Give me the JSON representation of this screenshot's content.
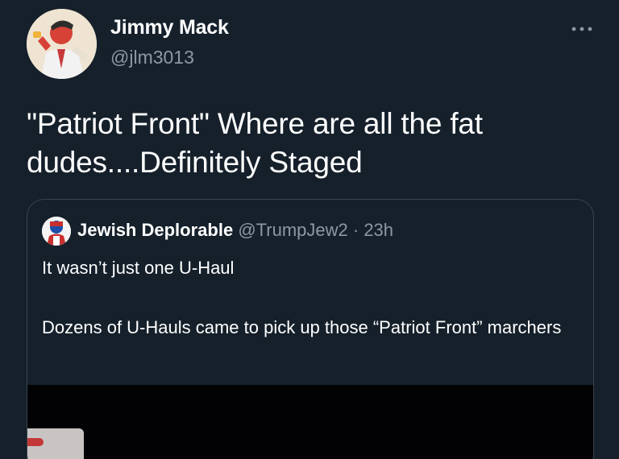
{
  "author": {
    "name": "Jimmy Mack",
    "handle": "@jlm3013"
  },
  "more_glyph": "···",
  "tweet": {
    "text_line1": "\"Patriot Front\" Where are all the fat",
    "text_line2": "dudes....Definitely Staged"
  },
  "quoted_tweet": {
    "name": "Jewish Deplorable",
    "handle": "@TrumpJew2",
    "separator": " · ",
    "time": "23h",
    "paragraph1": "It wasn’t just one U-Haul",
    "paragraph2": "Dozens of U-Hauls came to pick up those “Patriot Front” marchers"
  },
  "colors": {
    "background": "#15202b",
    "secondary_text": "#8b98a5",
    "border": "#38444d",
    "primary_text": "#ffffff"
  },
  "icons": {
    "more": "more-horizontal-icon",
    "author_avatar": "avatar-illustration",
    "quoted_avatar": "avatar-illustration"
  }
}
